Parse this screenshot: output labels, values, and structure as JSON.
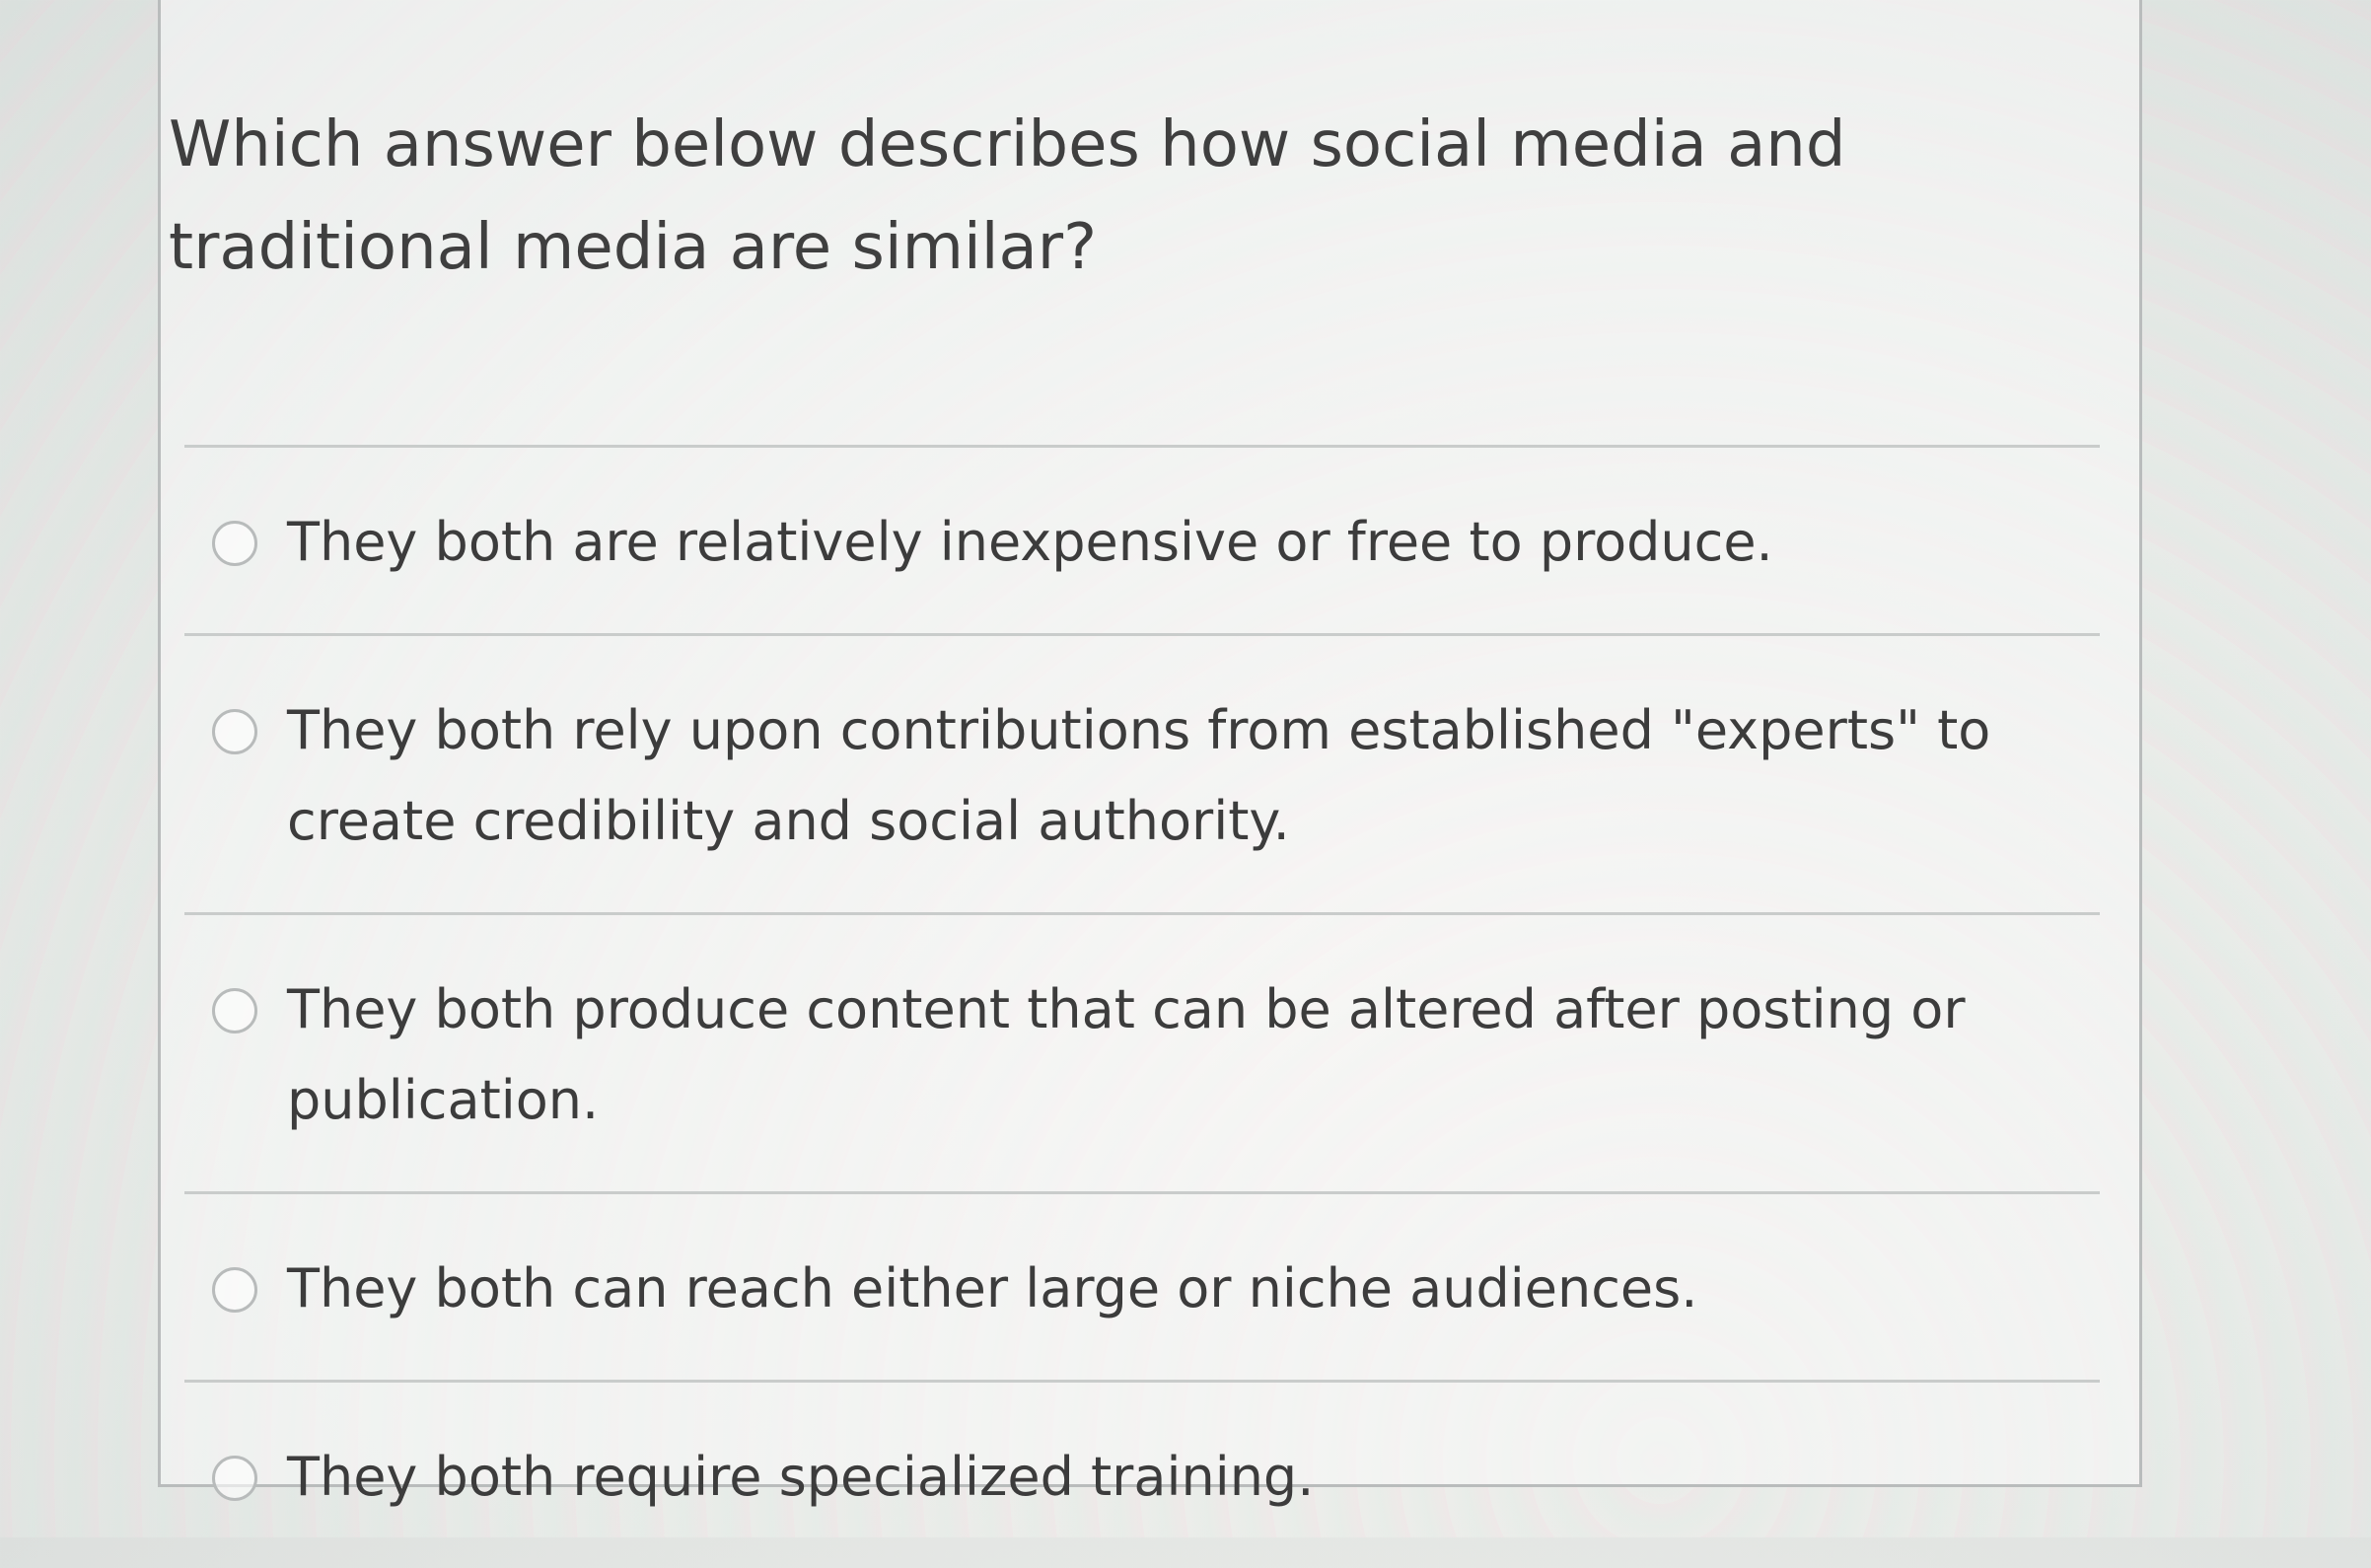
{
  "question": {
    "text": "Which answer below describes how social media and traditional media are similar?"
  },
  "options": [
    {
      "label": "They both are relatively inexpensive or free to produce.",
      "selected": false
    },
    {
      "label": "They both rely upon contributions from established \"experts\" to create credibility and social authority.",
      "selected": false
    },
    {
      "label": "They both produce content that can be altered after posting or publication.",
      "selected": false
    },
    {
      "label": "They both can reach either large or niche audiences.",
      "selected": false
    },
    {
      "label": "They both require specialized training.",
      "selected": false
    }
  ]
}
